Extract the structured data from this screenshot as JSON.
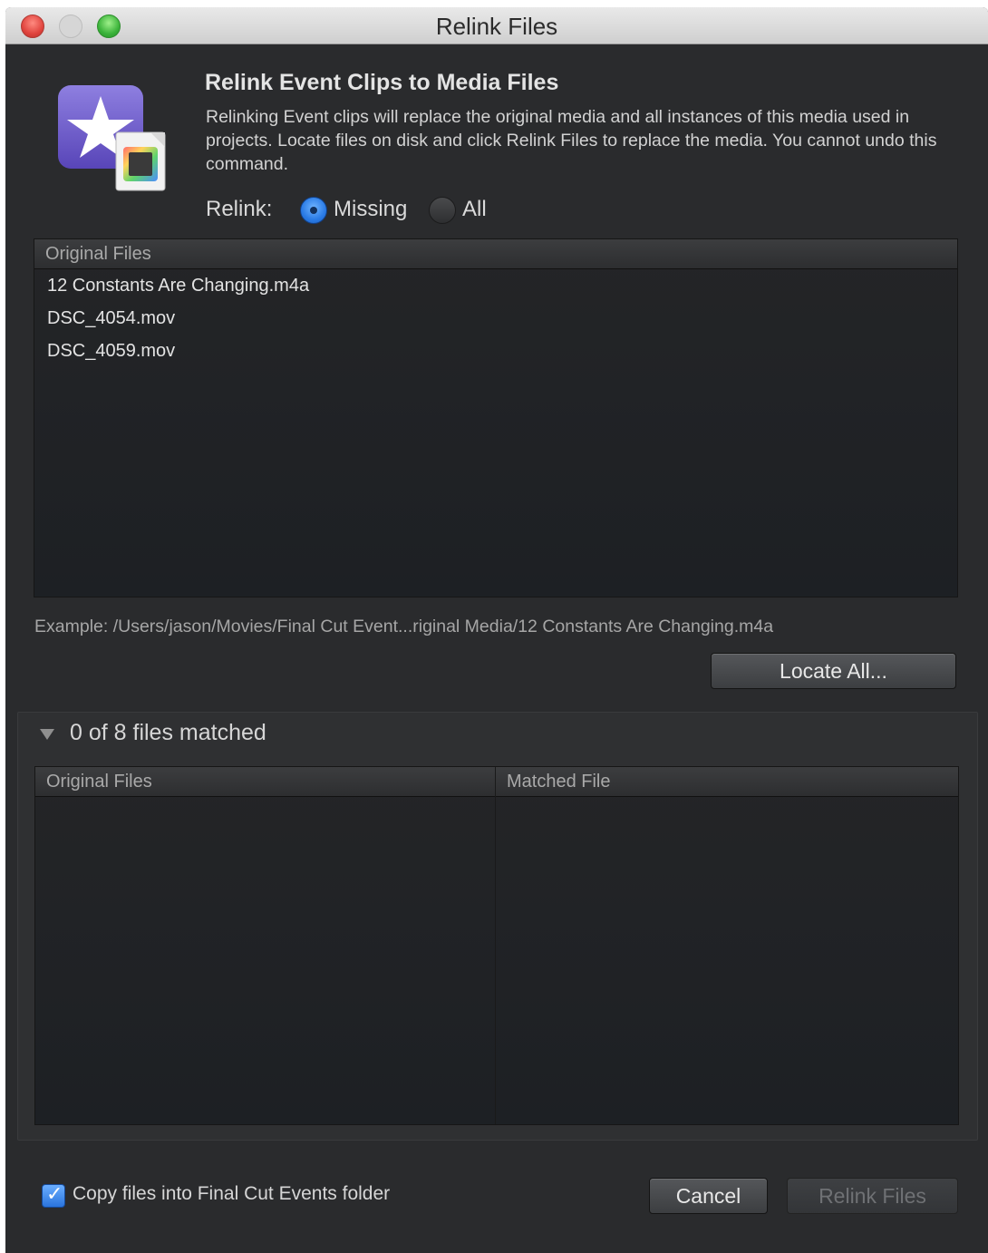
{
  "window": {
    "title": "Relink Files"
  },
  "header": {
    "title": "Relink Event Clips to Media Files",
    "description": "Relinking Event clips will replace the original media and all instances of this media used in projects. Locate files on disk and click Relink Files to replace the media. You cannot undo this command."
  },
  "relink": {
    "label": "Relink:",
    "options": [
      "Missing",
      "All"
    ],
    "selected": "Missing"
  },
  "original_files_table": {
    "header": "Original Files",
    "rows": [
      "12 Constants Are Changing.m4a",
      "DSC_4054.mov",
      "DSC_4059.mov"
    ]
  },
  "example_path": "Example: /Users/jason/Movies/Final Cut Event...riginal Media/12 Constants Are Changing.m4a",
  "locate_all_label": "Locate All...",
  "match_panel": {
    "status": "0 of 8 files matched",
    "columns": [
      "Original Files",
      "Matched File"
    ]
  },
  "footer": {
    "copy_checkbox_label": "Copy files into Final Cut Events folder",
    "copy_checked": true,
    "cancel_label": "Cancel",
    "relink_label": "Relink Files"
  }
}
